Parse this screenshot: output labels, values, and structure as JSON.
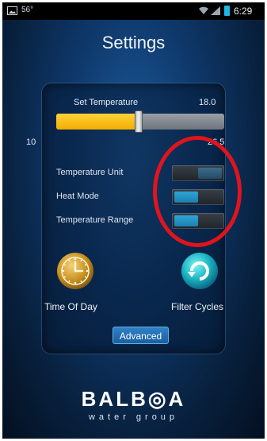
{
  "status_bar": {
    "temperature": "56°",
    "time": "6:29"
  },
  "title": "Settings",
  "set_temperature": {
    "label": "Set Temperature",
    "value": "18.0",
    "min_label": "10",
    "max_label": "26.5",
    "level": 0.49
  },
  "options": [
    {
      "label": "Temperature Unit",
      "state": "right"
    },
    {
      "label": "Heat Mode",
      "state": "left"
    },
    {
      "label": "Temperature Range",
      "state": "left"
    }
  ],
  "shortcuts": {
    "time_of_day": "Time Of Day",
    "filter_cycles": "Filter Cycles"
  },
  "advanced_button": "Advanced",
  "logo": {
    "name": "BALB◎A",
    "tagline": "water group"
  },
  "colors": {
    "slider_fill": "#f3ad00",
    "toggle_active": "#2fa4d6",
    "highlight": "#e0141d"
  }
}
